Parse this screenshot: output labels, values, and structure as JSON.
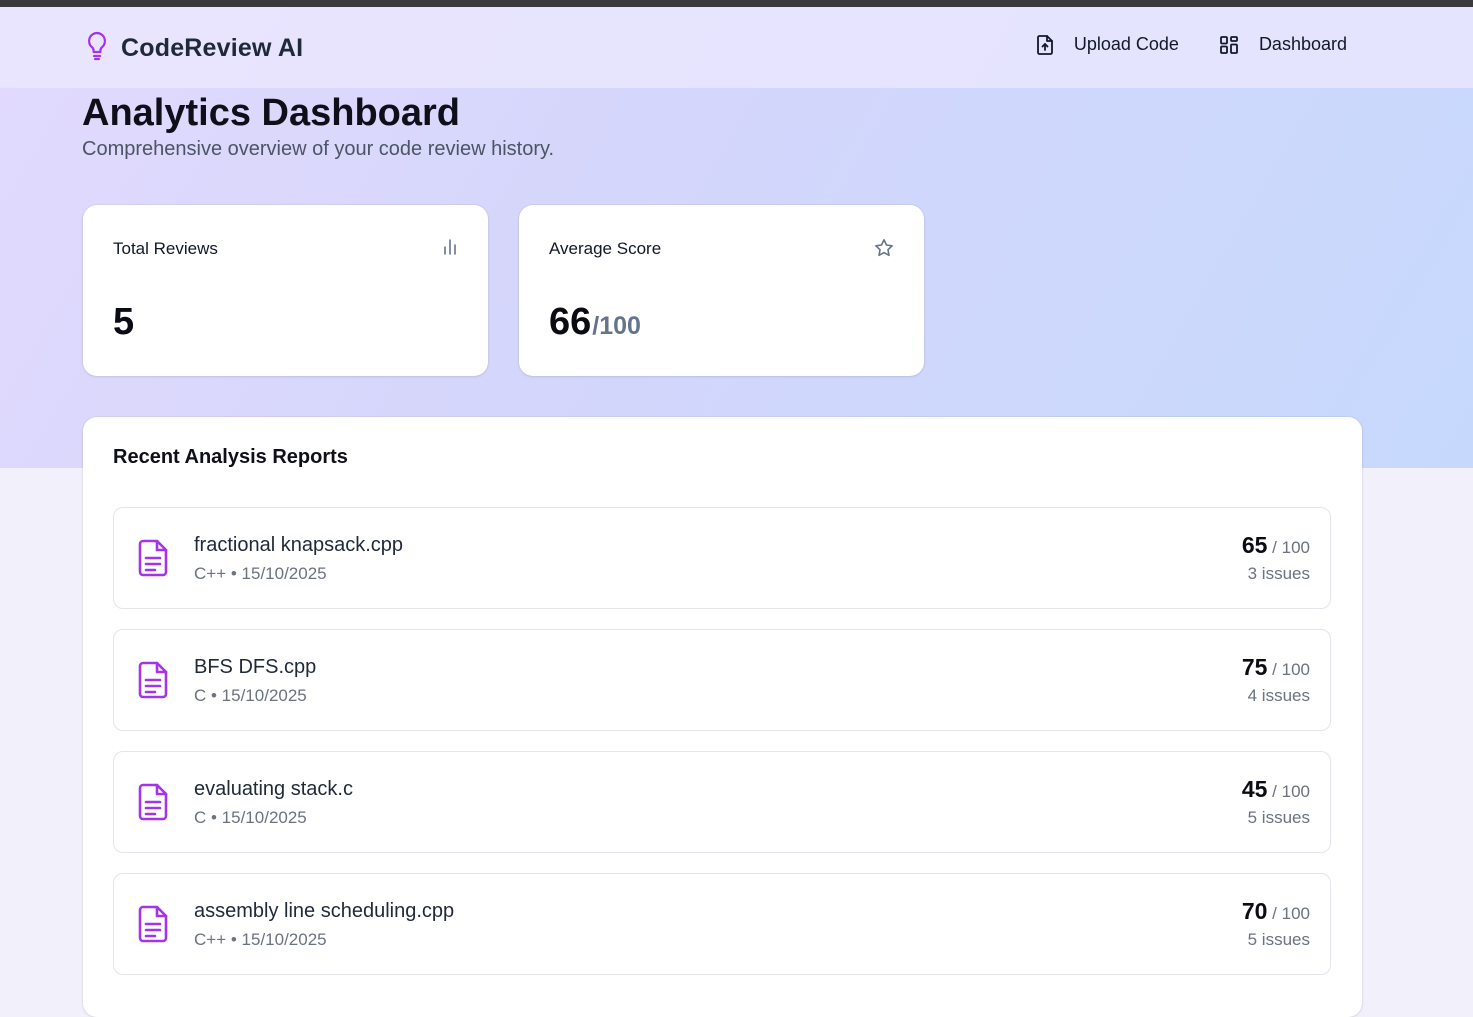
{
  "brand": {
    "name": "CodeReview AI",
    "icon": "lightbulb-icon",
    "accent": "#a533e8"
  },
  "nav": {
    "upload_label": "Upload Code",
    "dashboard_label": "Dashboard"
  },
  "page": {
    "title": "Analytics Dashboard",
    "subtitle": "Comprehensive overview of your code review history."
  },
  "stats": {
    "total_reviews": {
      "label": "Total Reviews",
      "value": "5",
      "icon": "bar-chart-icon"
    },
    "average_score": {
      "label": "Average Score",
      "value": "66",
      "suffix": "/100",
      "icon": "star-icon"
    }
  },
  "reports": {
    "title": "Recent Analysis Reports",
    "items": [
      {
        "name": "fractional knapsack.cpp",
        "meta": "C++ • 15/10/2025",
        "score": "65",
        "max": " / 100",
        "issues": "3 issues"
      },
      {
        "name": "BFS DFS.cpp",
        "meta": "C • 15/10/2025",
        "score": "75",
        "max": " / 100",
        "issues": "4 issues"
      },
      {
        "name": "evaluating stack.c",
        "meta": "C • 15/10/2025",
        "score": "45",
        "max": " / 100",
        "issues": "5 issues"
      },
      {
        "name": "assembly line scheduling.cpp",
        "meta": "C++ • 15/10/2025",
        "score": "70",
        "max": " / 100",
        "issues": "5 issues"
      }
    ]
  }
}
